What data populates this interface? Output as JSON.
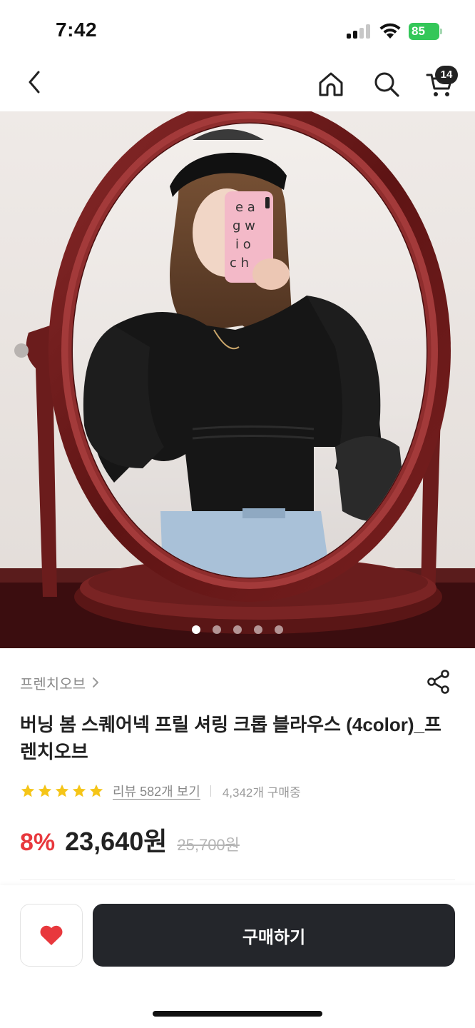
{
  "status_bar": {
    "time": "7:42",
    "battery": "85"
  },
  "nav": {
    "icons": [
      "back-chevron-icon",
      "home-icon",
      "search-icon",
      "cart-icon"
    ],
    "cart_count": "14"
  },
  "gallery": {
    "image": "product-photo",
    "slide_count": 5,
    "active_index": 0
  },
  "product": {
    "brand": "프렌치오브",
    "title": "버닝 봄 스퀘어넥 프릴 셔링 크롭 블라우스 (4color)_프렌치오브",
    "rating_stars": 5,
    "review_link": "리뷰 582개 보기",
    "buyers": "4,342개 구매중",
    "discount": "8%",
    "price": "23,640원",
    "original_price": "25,700원"
  },
  "actions": {
    "buy_label": "구매하기",
    "like_icon": "heart-icon"
  },
  "colors": {
    "discount": "#e8383d",
    "star": "#f5c518",
    "heart": "#e8383d",
    "buy_button": "#24262b",
    "battery": "#34c759"
  }
}
